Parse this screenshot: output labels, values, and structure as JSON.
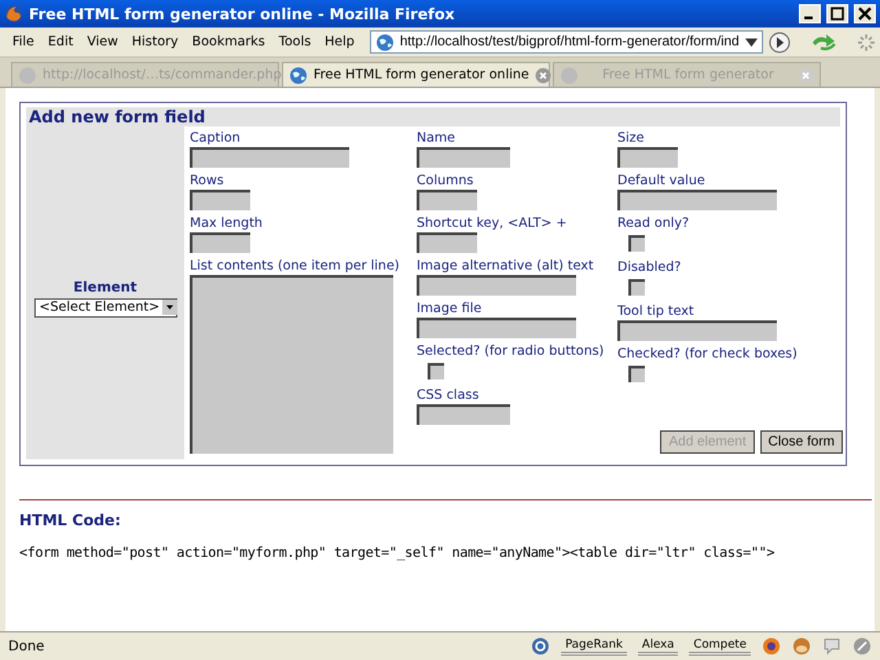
{
  "window": {
    "title": "Free HTML form generator online - Mozilla Firefox"
  },
  "menu": [
    "File",
    "Edit",
    "View",
    "History",
    "Bookmarks",
    "Tools",
    "Help"
  ],
  "address": {
    "value": "http://localhost/test/bigprof/html-form-generator/form/ind"
  },
  "tabs": [
    {
      "label": "http://localhost/…ts/commander.php",
      "selected": false
    },
    {
      "label": "Free HTML form generator online",
      "selected": true
    },
    {
      "label": "Free HTML form generator",
      "selected": false
    }
  ],
  "form": {
    "title": "Add new form field",
    "element": {
      "label": "Element",
      "value": "<Select Element>"
    },
    "columns": [
      [
        {
          "label": "Caption",
          "kind": "wide"
        },
        {
          "label": "Rows",
          "kind": "short"
        },
        {
          "label": "Max length",
          "kind": "short"
        },
        {
          "label": "List contents (one item per line)",
          "kind": "textarea"
        }
      ],
      [
        {
          "label": "Name",
          "kind": "medium"
        },
        {
          "label": "Columns",
          "kind": "short"
        },
        {
          "label": "Shortcut key, <ALT> +",
          "kind": "short"
        },
        {
          "label": "Image alternative (alt) text",
          "kind": "wide"
        },
        {
          "label": "Image file",
          "kind": "wide"
        },
        {
          "label": "Selected? (for radio buttons)",
          "kind": "checkbox",
          "checked": false
        },
        {
          "label": "CSS class",
          "kind": "medium"
        }
      ],
      [
        {
          "label": "Size",
          "kind": "short"
        },
        {
          "label": "Default value",
          "kind": "wide"
        },
        {
          "label": "Read only?",
          "kind": "checkbox",
          "checked": false
        },
        {
          "label": "Disabled?",
          "kind": "checkbox",
          "checked": false
        },
        {
          "label": "Tool tip text",
          "kind": "wide"
        },
        {
          "label": "Checked? (for check boxes)",
          "kind": "checkbox",
          "checked": false
        }
      ]
    ],
    "buttons": [
      {
        "label": "Add element",
        "disabled": true
      },
      {
        "label": "Close form",
        "disabled": false
      }
    ]
  },
  "code": {
    "heading": "HTML Code:",
    "text": "<form method=\"post\" action=\"myform.php\" target=\"_self\" name=\"anyName\"><table dir=\"ltr\" class=\"\">"
  },
  "status_bar": {
    "text": "Done",
    "meters": [
      "PageRank",
      "Alexa",
      "Compete"
    ]
  }
}
